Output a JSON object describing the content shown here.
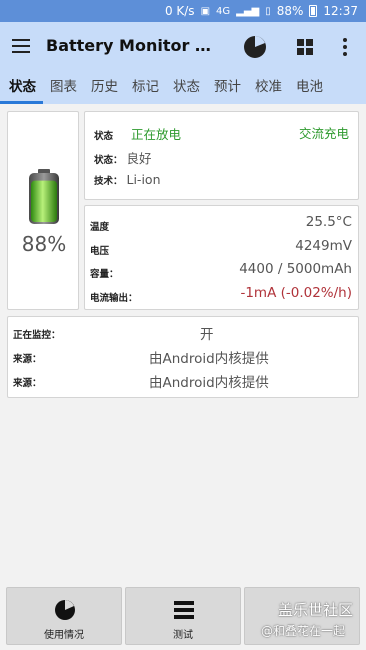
{
  "status_bar": {
    "network_speed": "0 K/s",
    "network_type": "4G",
    "battery_level": "88%",
    "time": "12:37"
  },
  "app_bar": {
    "title": "Battery Monitor Wid..."
  },
  "tabs": [
    {
      "label": "状态",
      "active": true
    },
    {
      "label": "图表",
      "active": false
    },
    {
      "label": "历史",
      "active": false
    },
    {
      "label": "标记",
      "active": false
    },
    {
      "label": "状态",
      "active": false
    },
    {
      "label": "预计",
      "active": false
    },
    {
      "label": "校准",
      "active": false
    },
    {
      "label": "电池",
      "active": false
    }
  ],
  "battery": {
    "percent": "88%",
    "level_fraction": 0.88
  },
  "status_card": {
    "status_label": "状态",
    "status_value": "正在放电",
    "charge_source": "交流充电",
    "health_label": "状态：",
    "health_value": "良好",
    "tech_label": "技术：",
    "tech_value": "Li-ion"
  },
  "sensor_card": {
    "temp_label": "温度",
    "temp_value": "25.5°C",
    "voltage_label": "电压",
    "voltage_value": "4249mV",
    "capacity_label": "容量：",
    "capacity_value": "4400 / 5000mAh",
    "current_label": "电流输出：",
    "current_value": "-1mA (-0.02%/h)"
  },
  "monitor_card": {
    "monitoring_label": "正在监控：",
    "monitoring_value": "开",
    "source1_label": "来源：",
    "source1_value": "由Android内核提供",
    "source2_label": "来源：",
    "source2_value": "由Android内核提供"
  },
  "bottom_bar": {
    "usage_label": "使用情况",
    "test_label": "测试",
    "watermark_main": "盖乐世社区",
    "watermark_sub": "@和叠花在一起"
  },
  "colors": {
    "status_bar": "#5d8fd8",
    "app_bar": "#c7dcf9",
    "tab_indicator": "#2979d8",
    "positive": "#2e9a2e",
    "negative": "#b0333a"
  }
}
